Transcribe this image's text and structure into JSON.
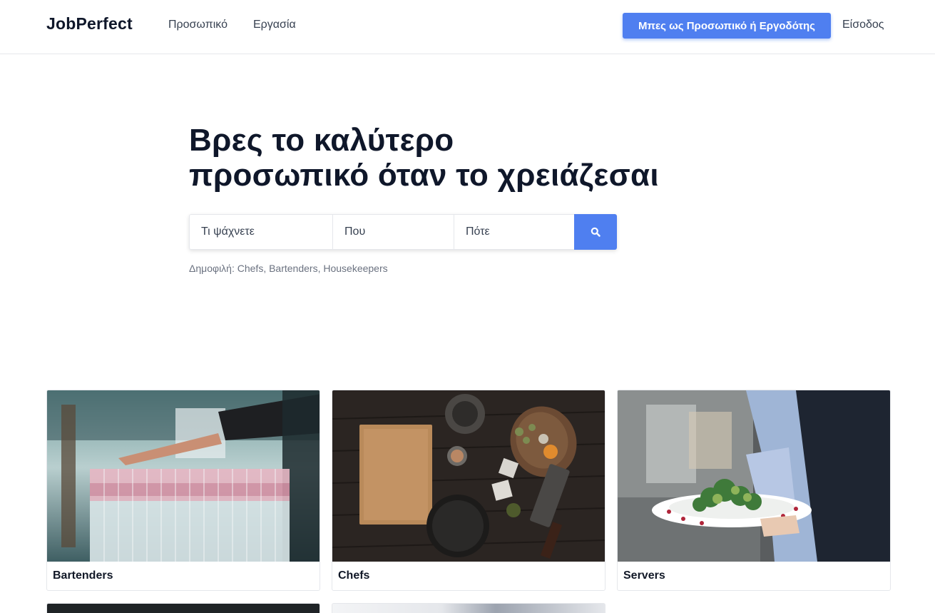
{
  "nav": {
    "logo": "JobPerfect",
    "links": [
      "Προσωπικό",
      "Εργασία"
    ],
    "cta_label": "Μπες ως Προσωπικό ή Εργοδότης",
    "login_label": "Είσοδος"
  },
  "hero": {
    "title_line1": "Βρες το καλύτερο",
    "title_line2": "προσωπικό όταν το χρειάζεσαι"
  },
  "search": {
    "what_placeholder": "Τι ψάχνετε",
    "where_placeholder": "Που",
    "when_placeholder": "Πότε",
    "button_icon": "search-icon"
  },
  "popular": "Δημοφιλή: Chefs, Bartenders, Housekeepers",
  "categories": [
    {
      "label": "Bartenders",
      "image": "bar-glasses-photo"
    },
    {
      "label": "Chefs",
      "image": "kitchen-table-photo"
    },
    {
      "label": "Servers",
      "image": "waiter-plate-photo"
    }
  ],
  "colors": {
    "accent": "#4f7ff0",
    "title": "#0f172a",
    "muted": "#6b7280"
  }
}
